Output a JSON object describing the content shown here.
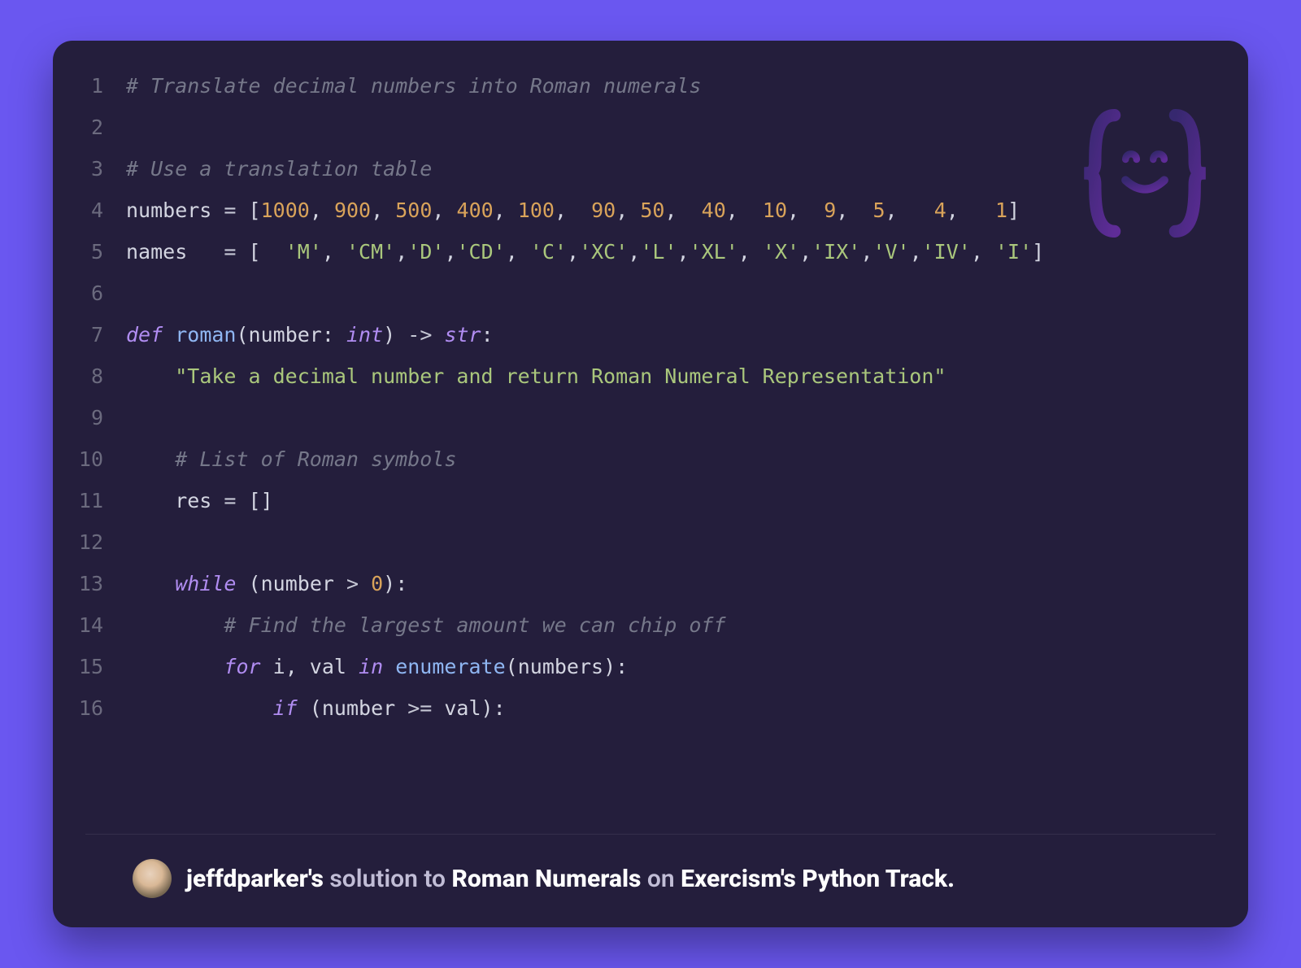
{
  "code": {
    "lines": [
      {
        "n": 1,
        "tokens": [
          {
            "c": "cm",
            "t": "# Translate decimal numbers into Roman numerals"
          }
        ]
      },
      {
        "n": 2,
        "tokens": []
      },
      {
        "n": 3,
        "tokens": [
          {
            "c": "cm",
            "t": "# Use a translation table"
          }
        ]
      },
      {
        "n": 4,
        "tokens": [
          {
            "c": "id",
            "t": "numbers "
          },
          {
            "c": "op",
            "t": "="
          },
          {
            "c": "id",
            "t": " "
          },
          {
            "c": "pu",
            "t": "["
          },
          {
            "c": "num",
            "t": "1000"
          },
          {
            "c": "pu",
            "t": ","
          },
          {
            "c": "id",
            "t": " "
          },
          {
            "c": "num",
            "t": "900"
          },
          {
            "c": "pu",
            "t": ","
          },
          {
            "c": "id",
            "t": " "
          },
          {
            "c": "num",
            "t": "500"
          },
          {
            "c": "pu",
            "t": ","
          },
          {
            "c": "id",
            "t": " "
          },
          {
            "c": "num",
            "t": "400"
          },
          {
            "c": "pu",
            "t": ","
          },
          {
            "c": "id",
            "t": " "
          },
          {
            "c": "num",
            "t": "100"
          },
          {
            "c": "pu",
            "t": ","
          },
          {
            "c": "id",
            "t": "  "
          },
          {
            "c": "num",
            "t": "90"
          },
          {
            "c": "pu",
            "t": ","
          },
          {
            "c": "id",
            "t": " "
          },
          {
            "c": "num",
            "t": "50"
          },
          {
            "c": "pu",
            "t": ","
          },
          {
            "c": "id",
            "t": "  "
          },
          {
            "c": "num",
            "t": "40"
          },
          {
            "c": "pu",
            "t": ","
          },
          {
            "c": "id",
            "t": "  "
          },
          {
            "c": "num",
            "t": "10"
          },
          {
            "c": "pu",
            "t": ","
          },
          {
            "c": "id",
            "t": "  "
          },
          {
            "c": "num",
            "t": "9"
          },
          {
            "c": "pu",
            "t": ","
          },
          {
            "c": "id",
            "t": "  "
          },
          {
            "c": "num",
            "t": "5"
          },
          {
            "c": "pu",
            "t": ","
          },
          {
            "c": "id",
            "t": "   "
          },
          {
            "c": "num",
            "t": "4"
          },
          {
            "c": "pu",
            "t": ","
          },
          {
            "c": "id",
            "t": "   "
          },
          {
            "c": "num",
            "t": "1"
          },
          {
            "c": "pu",
            "t": "]"
          }
        ]
      },
      {
        "n": 5,
        "tokens": [
          {
            "c": "id",
            "t": "names   "
          },
          {
            "c": "op",
            "t": "="
          },
          {
            "c": "id",
            "t": " "
          },
          {
            "c": "pu",
            "t": "["
          },
          {
            "c": "id",
            "t": "  "
          },
          {
            "c": "str",
            "t": "'M'"
          },
          {
            "c": "pu",
            "t": ","
          },
          {
            "c": "id",
            "t": " "
          },
          {
            "c": "str",
            "t": "'CM'"
          },
          {
            "c": "pu",
            "t": ","
          },
          {
            "c": "str",
            "t": "'D'"
          },
          {
            "c": "pu",
            "t": ","
          },
          {
            "c": "str",
            "t": "'CD'"
          },
          {
            "c": "pu",
            "t": ","
          },
          {
            "c": "id",
            "t": " "
          },
          {
            "c": "str",
            "t": "'C'"
          },
          {
            "c": "pu",
            "t": ","
          },
          {
            "c": "str",
            "t": "'XC'"
          },
          {
            "c": "pu",
            "t": ","
          },
          {
            "c": "str",
            "t": "'L'"
          },
          {
            "c": "pu",
            "t": ","
          },
          {
            "c": "str",
            "t": "'XL'"
          },
          {
            "c": "pu",
            "t": ","
          },
          {
            "c": "id",
            "t": " "
          },
          {
            "c": "str",
            "t": "'X'"
          },
          {
            "c": "pu",
            "t": ","
          },
          {
            "c": "str",
            "t": "'IX'"
          },
          {
            "c": "pu",
            "t": ","
          },
          {
            "c": "str",
            "t": "'V'"
          },
          {
            "c": "pu",
            "t": ","
          },
          {
            "c": "str",
            "t": "'IV'"
          },
          {
            "c": "pu",
            "t": ","
          },
          {
            "c": "id",
            "t": " "
          },
          {
            "c": "str",
            "t": "'I'"
          },
          {
            "c": "pu",
            "t": "]"
          }
        ]
      },
      {
        "n": 6,
        "tokens": []
      },
      {
        "n": 7,
        "tokens": [
          {
            "c": "kw",
            "t": "def"
          },
          {
            "c": "id",
            "t": " "
          },
          {
            "c": "fn",
            "t": "roman"
          },
          {
            "c": "pu",
            "t": "("
          },
          {
            "c": "id",
            "t": "number"
          },
          {
            "c": "pu",
            "t": ":"
          },
          {
            "c": "id",
            "t": " "
          },
          {
            "c": "ty",
            "t": "int"
          },
          {
            "c": "pu",
            "t": ")"
          },
          {
            "c": "id",
            "t": " "
          },
          {
            "c": "op",
            "t": "->"
          },
          {
            "c": "id",
            "t": " "
          },
          {
            "c": "ty",
            "t": "str"
          },
          {
            "c": "pu",
            "t": ":"
          }
        ]
      },
      {
        "n": 8,
        "tokens": [
          {
            "c": "id",
            "t": "    "
          },
          {
            "c": "str",
            "t": "\"Take a decimal number and return Roman Numeral Representation\""
          }
        ]
      },
      {
        "n": 9,
        "tokens": []
      },
      {
        "n": 10,
        "tokens": [
          {
            "c": "id",
            "t": "    "
          },
          {
            "c": "cm",
            "t": "# List of Roman symbols"
          }
        ]
      },
      {
        "n": 11,
        "tokens": [
          {
            "c": "id",
            "t": "    res "
          },
          {
            "c": "op",
            "t": "="
          },
          {
            "c": "id",
            "t": " "
          },
          {
            "c": "pu",
            "t": "[]"
          }
        ]
      },
      {
        "n": 12,
        "tokens": []
      },
      {
        "n": 13,
        "tokens": [
          {
            "c": "id",
            "t": "    "
          },
          {
            "c": "kw",
            "t": "while"
          },
          {
            "c": "id",
            "t": " "
          },
          {
            "c": "pu",
            "t": "("
          },
          {
            "c": "id",
            "t": "number "
          },
          {
            "c": "op",
            "t": ">"
          },
          {
            "c": "id",
            "t": " "
          },
          {
            "c": "num",
            "t": "0"
          },
          {
            "c": "pu",
            "t": "):"
          }
        ]
      },
      {
        "n": 14,
        "tokens": [
          {
            "c": "id",
            "t": "        "
          },
          {
            "c": "cm",
            "t": "# Find the largest amount we can chip off"
          }
        ]
      },
      {
        "n": 15,
        "tokens": [
          {
            "c": "id",
            "t": "        "
          },
          {
            "c": "kw",
            "t": "for"
          },
          {
            "c": "id",
            "t": " i"
          },
          {
            "c": "pu",
            "t": ","
          },
          {
            "c": "id",
            "t": " val "
          },
          {
            "c": "kw",
            "t": "in"
          },
          {
            "c": "id",
            "t": " "
          },
          {
            "c": "fn",
            "t": "enumerate"
          },
          {
            "c": "pu",
            "t": "("
          },
          {
            "c": "id",
            "t": "numbers"
          },
          {
            "c": "pu",
            "t": "):"
          }
        ]
      },
      {
        "n": 16,
        "tokens": [
          {
            "c": "id",
            "t": "            "
          },
          {
            "c": "kw",
            "t": "if"
          },
          {
            "c": "id",
            "t": " "
          },
          {
            "c": "pu",
            "t": "("
          },
          {
            "c": "id",
            "t": "number "
          },
          {
            "c": "op",
            "t": ">="
          },
          {
            "c": "id",
            "t": " val"
          },
          {
            "c": "pu",
            "t": "):"
          }
        ]
      }
    ]
  },
  "footer": {
    "user": "jeffdparker's ",
    "solution_to": "solution to ",
    "exercise": "Roman Numerals ",
    "on": "on ",
    "site": "Exercism's ",
    "track": "Python Track."
  }
}
